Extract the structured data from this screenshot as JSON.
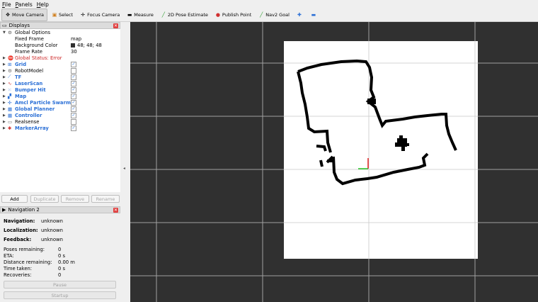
{
  "menu": [
    "File",
    "Panels",
    "Help"
  ],
  "toolbar": [
    {
      "label": "Move Camera",
      "icon": "move-camera-icon",
      "active": true
    },
    {
      "label": "Select",
      "icon": "select-icon",
      "active": false
    },
    {
      "label": "Focus Camera",
      "icon": "focus-camera-icon",
      "active": false
    },
    {
      "label": "Measure",
      "icon": "measure-icon",
      "active": false
    },
    {
      "label": "2D Pose Estimate",
      "icon": "pose-estimate-icon",
      "active": false
    },
    {
      "label": "Publish Point",
      "icon": "publish-point-icon",
      "active": false
    },
    {
      "label": "Nav2 Goal",
      "icon": "nav2-goal-icon",
      "active": false
    }
  ],
  "displays": {
    "title": "Displays",
    "global_options": {
      "label": "Global Options",
      "props": [
        {
          "label": "Fixed Frame",
          "value": "map"
        },
        {
          "label": "Background Color",
          "value": "48; 48; 48",
          "swatch": "#303030"
        },
        {
          "label": "Frame Rate",
          "value": "30"
        }
      ]
    },
    "global_status": "Global Status: Error",
    "items": [
      {
        "label": "Grid",
        "checked": true,
        "color": "#2a6fd6",
        "icon": "grid-icon"
      },
      {
        "label": "RobotModel",
        "checked": false,
        "color": "#000000",
        "icon": "robot-model-icon"
      },
      {
        "label": "TF",
        "checked": true,
        "color": "#2a6fd6",
        "icon": "tf-icon"
      },
      {
        "label": "LaserScan",
        "checked": true,
        "color": "#2a6fd6",
        "icon": "laser-scan-icon"
      },
      {
        "label": "Bumper Hit",
        "checked": true,
        "color": "#2a6fd6",
        "icon": "bumper-hit-icon"
      },
      {
        "label": "Map",
        "checked": true,
        "color": "#2a6fd6",
        "icon": "map-icon"
      },
      {
        "label": "Amcl Particle Swarm",
        "checked": true,
        "color": "#2a6fd6",
        "icon": "particle-swarm-icon"
      },
      {
        "label": "Global Planner",
        "checked": true,
        "color": "#2a6fd6",
        "icon": "global-planner-icon"
      },
      {
        "label": "Controller",
        "checked": true,
        "color": "#2a6fd6",
        "icon": "controller-icon"
      },
      {
        "label": "Realsense",
        "checked": false,
        "color": "#000000",
        "icon": "realsense-icon"
      },
      {
        "label": "MarkerArray",
        "checked": true,
        "color": "#2a6fd6",
        "icon": "marker-array-icon"
      }
    ],
    "buttons": {
      "add": "Add",
      "duplicate": "Duplicate",
      "remove": "Remove",
      "rename": "Rename"
    }
  },
  "navigation": {
    "title": "Navigation 2",
    "navigation_label": "Navigation:",
    "navigation_value": "unknown",
    "localization_label": "Localization:",
    "localization_value": "unknown",
    "feedback_label": "Feedback:",
    "feedback_value": "unknown",
    "stats": [
      {
        "label": "Poses remaining:",
        "value": "0"
      },
      {
        "label": "ETA:",
        "value": "0 s"
      },
      {
        "label": "Distance remaining:",
        "value": "0.00 m"
      },
      {
        "label": "Time taken:",
        "value": "0 s"
      },
      {
        "label": "Recoveries:",
        "value": "0"
      }
    ],
    "pause": "Pause",
    "startup": "Startup"
  },
  "colors": {
    "viewport_bg": "#303030",
    "map_free": "#ffffff",
    "wall": "#000000",
    "error": "#cc2222",
    "accent": "#2a6fd6"
  }
}
